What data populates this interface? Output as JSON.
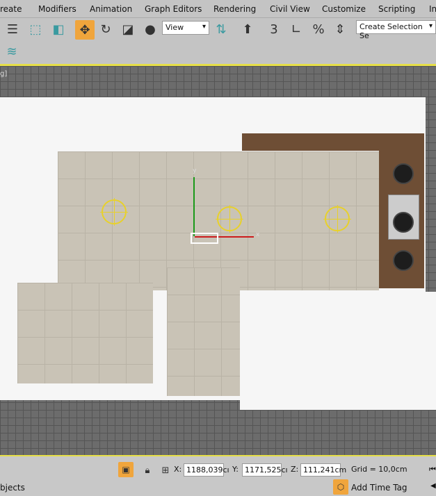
{
  "menu": [
    "reate",
    "Modifiers",
    "Animation",
    "Graph Editors",
    "Rendering",
    "Civil View",
    "Customize",
    "Scripting",
    "In"
  ],
  "toolbar": {
    "view_select": "View",
    "selection_set": "Create Selection Se",
    "active_tool": "move"
  },
  "viewport": {
    "label": "g]",
    "axis_x": "x",
    "axis_y": "y",
    "accent": "#e6df48"
  },
  "status": {
    "x_label": "X:",
    "x_value": "1188,039cı",
    "y_label": "Y:",
    "y_value": "1171,525cı",
    "z_label": "Z:",
    "z_value": "111,241cm",
    "grid": "Grid = 10,0cm",
    "add_time_tag": "Add Time Tag",
    "left_text": "bjects"
  }
}
